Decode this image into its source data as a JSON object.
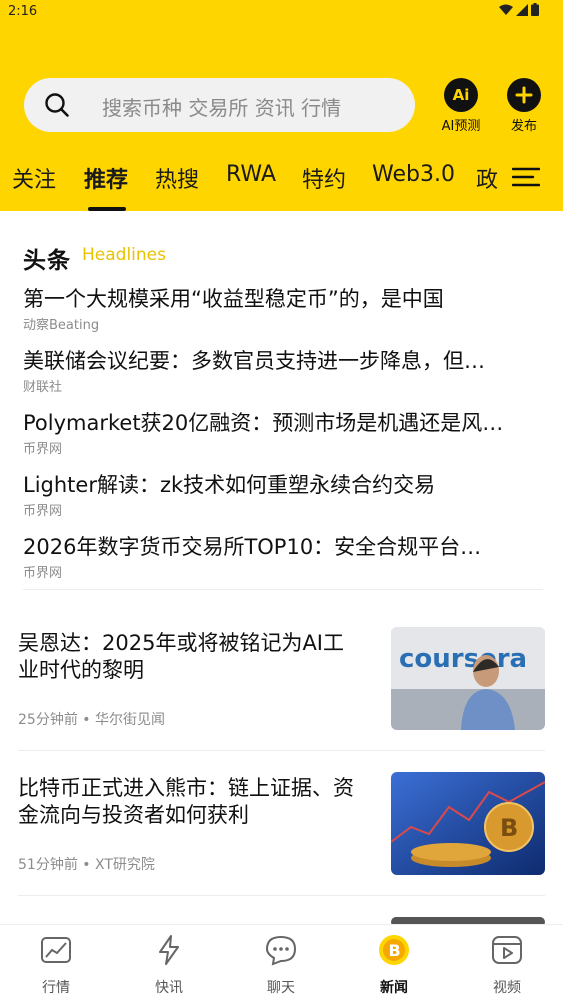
{
  "status": {
    "time": "2:16"
  },
  "search": {
    "placeholder": "搜索币种 交易所 资讯 行情"
  },
  "header_actions": {
    "ai_label": "AI预测",
    "ai_icon_text": "Ai",
    "publish_label": "发布"
  },
  "tabs": [
    {
      "label": "关注",
      "active": false
    },
    {
      "label": "推荐",
      "active": true
    },
    {
      "label": "热搜",
      "active": false
    },
    {
      "label": "RWA",
      "active": false
    },
    {
      "label": "特约",
      "active": false
    },
    {
      "label": "Web3.0",
      "active": false
    },
    {
      "label": "政",
      "active": false
    }
  ],
  "headlines": {
    "title": "头条",
    "subtitle": "Headlines",
    "items": [
      {
        "title": "第一个大规模采用“收益型稳定币”的，是中国",
        "source": "动察Beating"
      },
      {
        "title": "美联储会议纪要：多数官员支持进一步降息，但…",
        "source": "财联社"
      },
      {
        "title": "Polymarket获20亿融资：预测市场是机遇还是风…",
        "source": "币界网"
      },
      {
        "title": "Lighter解读：zk技术如何重塑永续合约交易",
        "source": "币界网"
      },
      {
        "title": "2026年数字货币交易所TOP10：安全合规平台…",
        "source": "币界网"
      }
    ]
  },
  "articles": [
    {
      "title": "吴恩达：2025年或将被铭记为AI工业时代的黎明",
      "meta": "25分钟前 • 华尔街见闻",
      "thumb_text": "coursera"
    },
    {
      "title": "比特币正式进入熊市：链上证据、资金流向与投资者如何获利",
      "meta": "51分钟前 • XT研究院",
      "thumb_text": ""
    }
  ],
  "bottom_nav": [
    {
      "label": "行情",
      "icon": "chart-icon",
      "active": false
    },
    {
      "label": "快讯",
      "icon": "lightning-icon",
      "active": false
    },
    {
      "label": "聊天",
      "icon": "chat-icon",
      "active": false
    },
    {
      "label": "新闻",
      "icon": "bitcoin-news-icon",
      "active": true
    },
    {
      "label": "视频",
      "icon": "video-icon",
      "active": false
    }
  ],
  "colors": {
    "brand_yellow": "#FFD500",
    "subtitle_yellow": "#E9C200"
  }
}
